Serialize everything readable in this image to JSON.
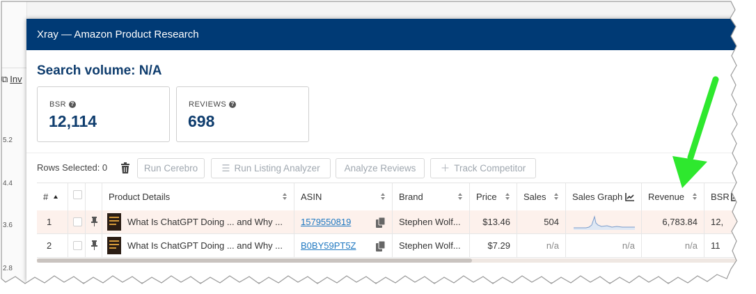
{
  "background": {
    "link_label": "Inv",
    "axis_ticks": [
      "5.2",
      "4.4",
      "3.6",
      "2.8"
    ]
  },
  "dialog": {
    "title": "Xray — Amazon Product Research",
    "search_volume": "Search volume: N/A"
  },
  "cards": {
    "bsr": {
      "label": "BSR",
      "value": "12,114",
      "help_icon": "question-circle-icon"
    },
    "reviews": {
      "label": "REVIEWS",
      "value": "698",
      "help_icon": "question-circle-icon"
    }
  },
  "toolbar": {
    "rows_selected": "Rows Selected: 0",
    "run_cerebro": "Run Cerebro",
    "run_listing_analyzer": "Run Listing Analyzer",
    "analyze_reviews": "Analyze Reviews",
    "track_competitor": "Track Competitor"
  },
  "table": {
    "headers": {
      "num": "#",
      "product_details": "Product Details",
      "asin": "ASIN",
      "brand": "Brand",
      "price": "Price",
      "sales": "Sales",
      "sales_graph": "Sales Graph",
      "revenue": "Revenue",
      "bsr": "BSR"
    },
    "rows": [
      {
        "num": "1",
        "title": "What Is ChatGPT Doing ... and Why ...",
        "asin": "1579550819",
        "brand": "Stephen Wolf...",
        "price": "$13.46",
        "sales": "504",
        "sales_graph": "",
        "revenue": "6,783.84",
        "bsr": "12,"
      },
      {
        "num": "2",
        "title": "What Is ChatGPT Doing ... and Why ...",
        "asin": "B0BY59PT5Z",
        "brand": "Stephen Wolf...",
        "price": "$7.29",
        "sales": "n/a",
        "sales_graph": "n/a",
        "revenue": "n/a",
        "bsr": "11"
      }
    ]
  },
  "colors": {
    "title_bar": "#003a75",
    "heading": "#0f3d6e",
    "link": "#1f78c1",
    "selected_row": "#fdf1ec",
    "annotation_arrow": "#2ee82e"
  }
}
